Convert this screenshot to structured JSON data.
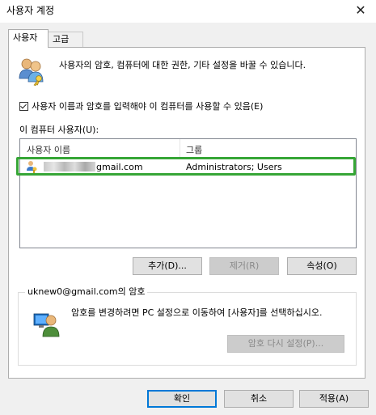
{
  "window": {
    "title": "사용자 계정",
    "close_glyph": "✕"
  },
  "tabs": [
    {
      "label": "사용자",
      "active": true
    },
    {
      "label": "고급",
      "active": false
    }
  ],
  "description": "사용자의 암호, 컴퓨터에 대한 권한, 기타 설정을 바꿀 수 있습니다.",
  "require_password": {
    "label": "사용자 이름과 암호를 입력해야 이 컴퓨터를 사용할 수 있음(E)",
    "checked": true
  },
  "users_list": {
    "label": "이 컴퓨터 사용자(U):",
    "columns": [
      "사용자 이름",
      "그룹"
    ],
    "rows": [
      {
        "user_visible_suffix": "gmail.com",
        "group": "Administrators; Users",
        "selected": true
      }
    ]
  },
  "list_buttons": {
    "add": "추가(D)...",
    "remove": "제거(R)",
    "properties": "속성(O)"
  },
  "password_group": {
    "title": "uknew0@gmail.com의 암호",
    "text": "암호를 변경하려면 PC 설정으로 이동하여 [사용자]를 선택하십시오.",
    "reset_button": "암호 다시 설정(P)..."
  },
  "dialog_buttons": {
    "ok": "확인",
    "cancel": "취소",
    "apply": "적용(A)"
  },
  "colors": {
    "highlight_border": "#36a636",
    "focus_border": "#0078d7"
  },
  "icons": [
    "users-icon",
    "user-key-icon",
    "user-pc-icon",
    "close-icon",
    "checkmark-icon"
  ]
}
